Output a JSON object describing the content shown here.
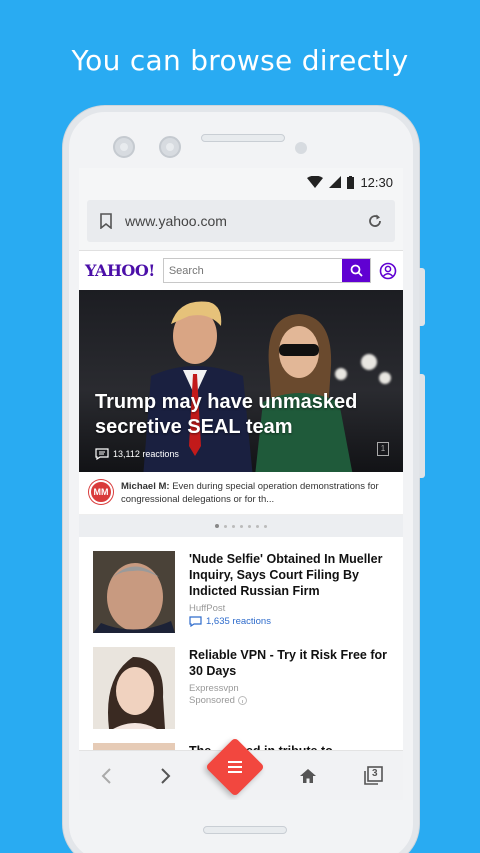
{
  "promo": {
    "headline": "You can browse directly"
  },
  "status": {
    "time": "12:30"
  },
  "browser": {
    "url": "www.yahoo.com"
  },
  "yahoo": {
    "logo": "YAHOO!",
    "search_placeholder": "Search"
  },
  "hero": {
    "title": "Trump may have unmasked secretive SEAL team",
    "reactions": "13,112 reactions",
    "page_indicator": "1"
  },
  "comment": {
    "avatar": "MM",
    "author": "Michael M:",
    "text": "Even during special operation demonstrations for congressional delegations or for th..."
  },
  "articles": [
    {
      "title": "'Nude Selfie' Obtained In Mueller Inquiry, Says Court Filing By Indicted Russian Firm",
      "source": "HuffPost",
      "reactions": "1,635 reactions"
    },
    {
      "title": "Reliable VPN - Try it Risk Free for 30 Days",
      "source": "Expressvpn",
      "sponsored": "Sponsored"
    },
    {
      "title": "The... ...ised in tribute to"
    }
  ],
  "nav": {
    "tabs_count": "3"
  },
  "colors": {
    "background": "#29abf2",
    "yahoo_purple": "#6001d2",
    "fab_red": "#f2473f",
    "link_blue": "#2f6ccc"
  }
}
